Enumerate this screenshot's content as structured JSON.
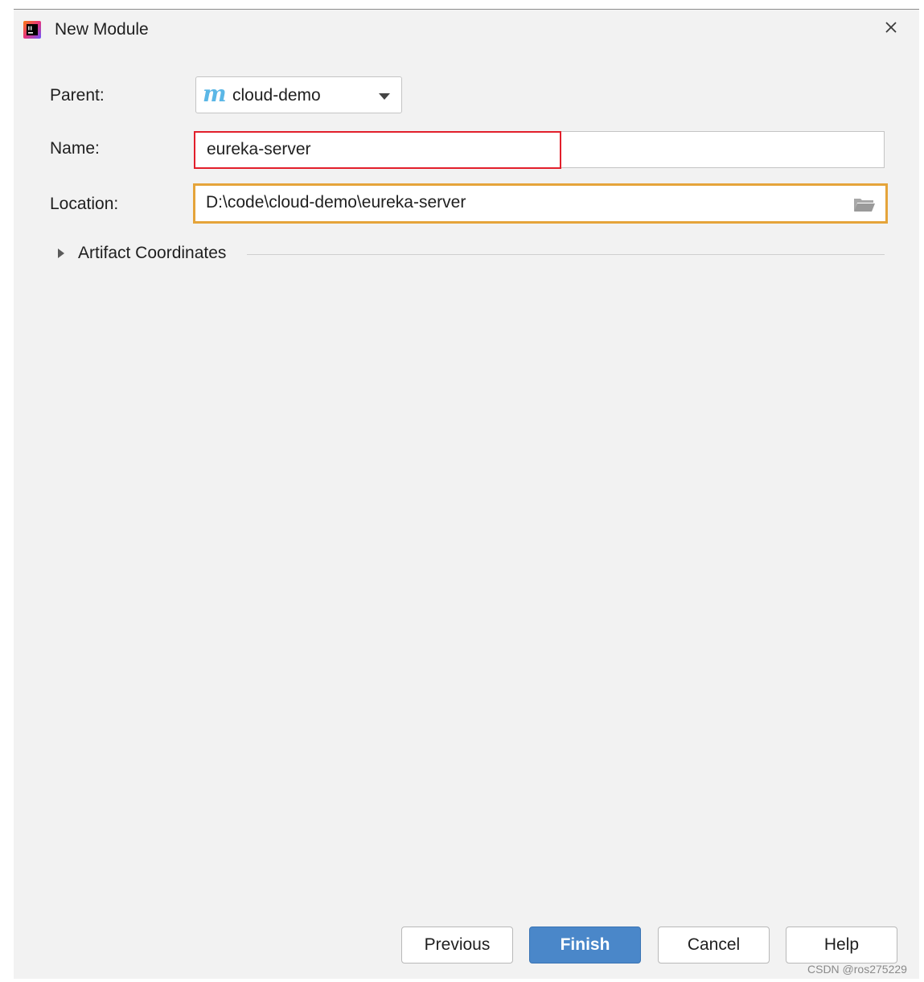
{
  "window": {
    "title": "New Module",
    "app_icon": "intellij-idea-icon",
    "close_icon": "close-icon"
  },
  "form": {
    "parent": {
      "label": "Parent:",
      "value": "cloud-demo",
      "icon_letter": "m",
      "icon": "maven-icon"
    },
    "name": {
      "label": "Name:",
      "value": "eureka-server"
    },
    "location": {
      "label": "Location:",
      "value": "D:\\code\\cloud-demo\\eureka-server",
      "browse_icon": "folder-icon"
    },
    "artifact_coordinates": {
      "label": "Artifact Coordinates",
      "expanded": false
    }
  },
  "highlights": {
    "name_color": "#e21f2b",
    "location_color": "#e5a43a"
  },
  "buttons": {
    "previous": "Previous",
    "finish": "Finish",
    "cancel": "Cancel",
    "help": "Help"
  },
  "watermark": "CSDN @ros275229",
  "colors": {
    "accent": "#4a87c9",
    "background": "#f2f2f2"
  }
}
